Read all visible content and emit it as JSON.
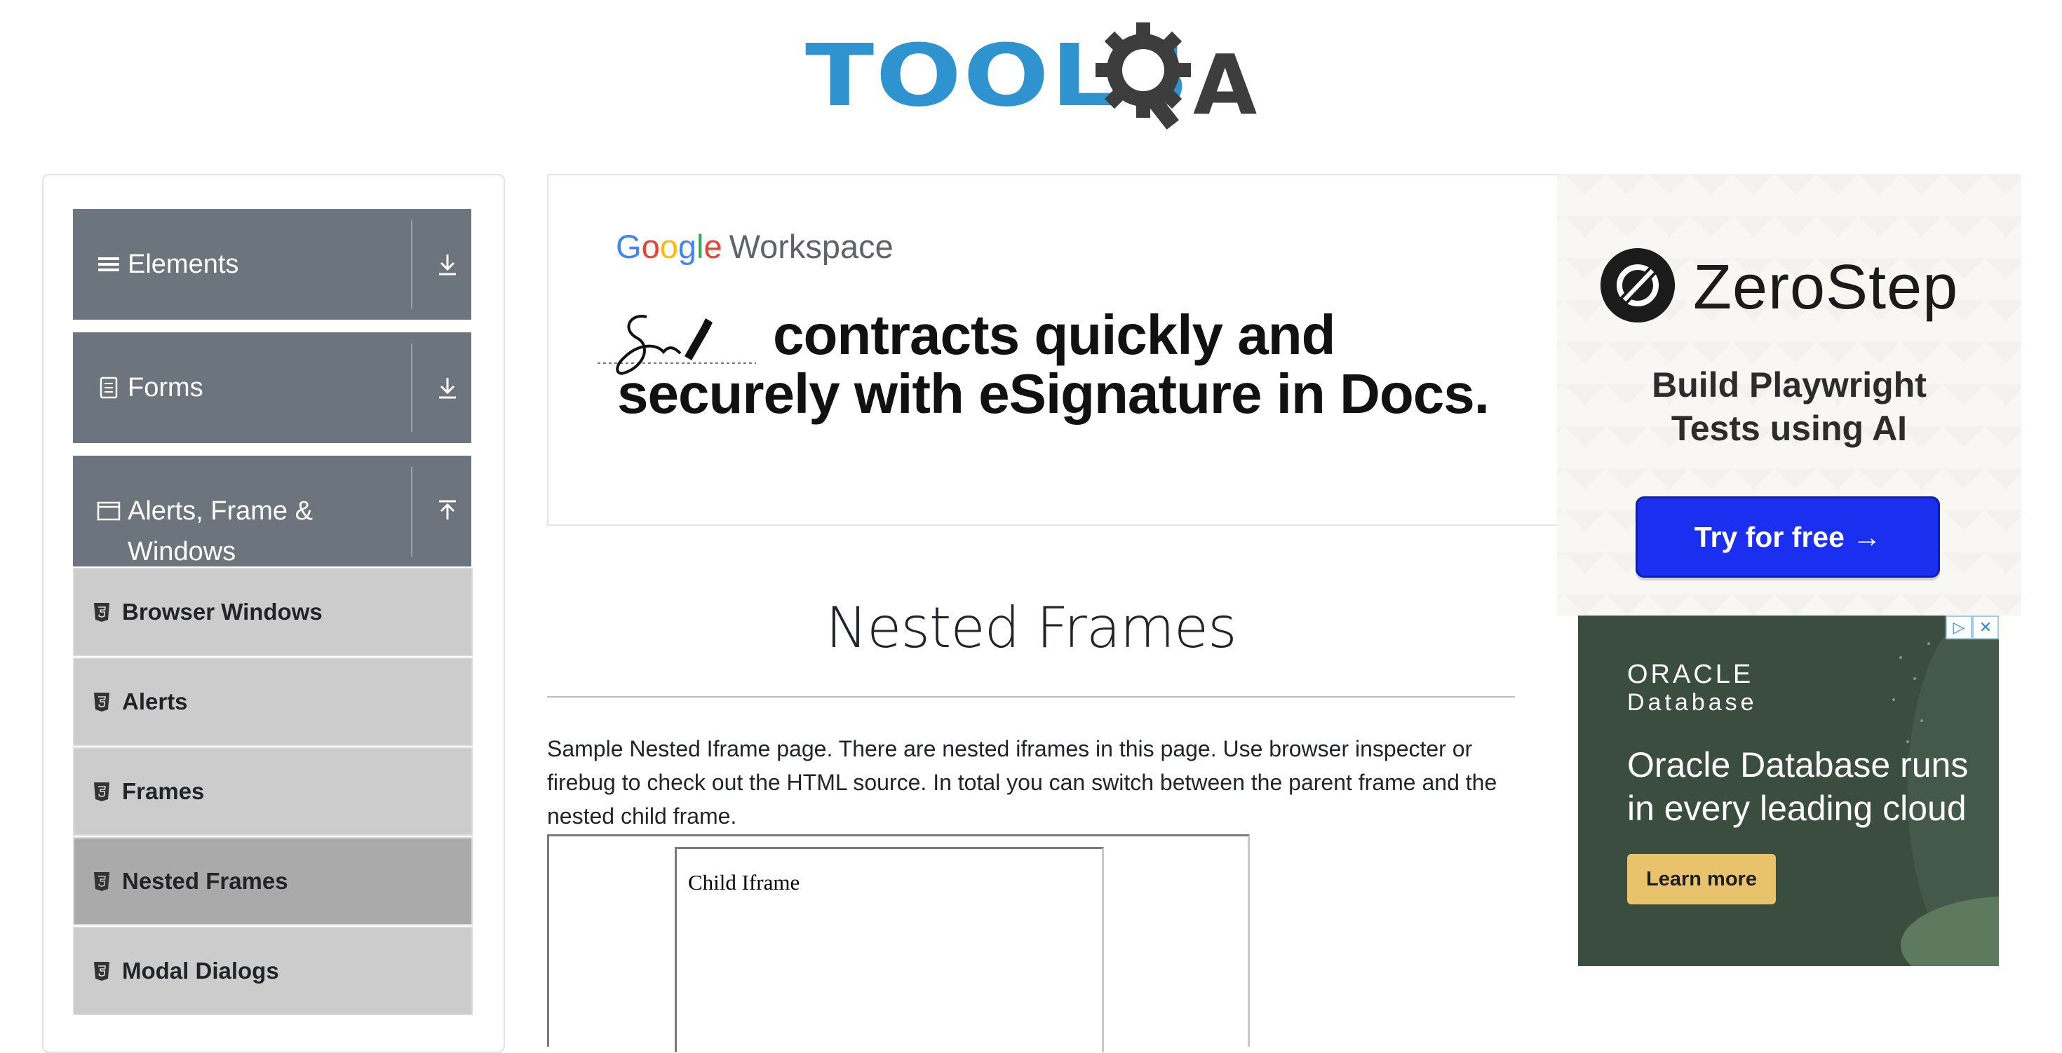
{
  "header": {
    "logo_text": "TOOLS",
    "logo_a": "A"
  },
  "sidebar": {
    "groups": [
      {
        "label": "Elements",
        "icon": "list-icon",
        "toggle": "download-icon"
      },
      {
        "label": "Forms",
        "icon": "document-icon",
        "toggle": "download-icon"
      },
      {
        "label": "Alerts, Frame &",
        "label2": "Windows",
        "icon": "window-icon",
        "toggle": "upload-icon"
      }
    ],
    "items": [
      {
        "label": "Browser Windows",
        "active": false
      },
      {
        "label": "Alerts",
        "active": false
      },
      {
        "label": "Frames",
        "active": false
      },
      {
        "label": "Nested Frames",
        "active": true
      },
      {
        "label": "Modal Dialogs",
        "active": false
      }
    ]
  },
  "google_ad": {
    "brand_google": "Google",
    "brand_workspace": "Workspace",
    "headline_1": "contracts quickly and",
    "headline_2": "securely with eSignature in Docs."
  },
  "main": {
    "title": "Nested Frames",
    "description": "Sample Nested Iframe page. There are nested iframes in this page. Use browser inspecter or firebug to check out the HTML source. In total you can switch between the parent frame and the nested child frame.",
    "child_frame_text": "Child Iframe"
  },
  "zerostep_ad": {
    "brand": "ZeroStep",
    "tagline_1": "Build Playwright",
    "tagline_2": "Tests using AI",
    "cta": "Try for free →"
  },
  "oracle_ad": {
    "logo_1": "ORACLE",
    "logo_2": "Database",
    "headline": "Oracle Database runs in every leading cloud",
    "cta": "Learn more",
    "adchoices_1": "▷",
    "adchoices_2": "✕"
  },
  "colors": {
    "sidebar_header": "#6c757d",
    "sidebar_item": "#cccccc",
    "sidebar_item_active": "#aaaaaa",
    "logo_blue": "#2e93cf",
    "zerostep_button": "#1a2ff0",
    "oracle_bg": "#3a4d3f",
    "oracle_button": "#e9c26c"
  }
}
